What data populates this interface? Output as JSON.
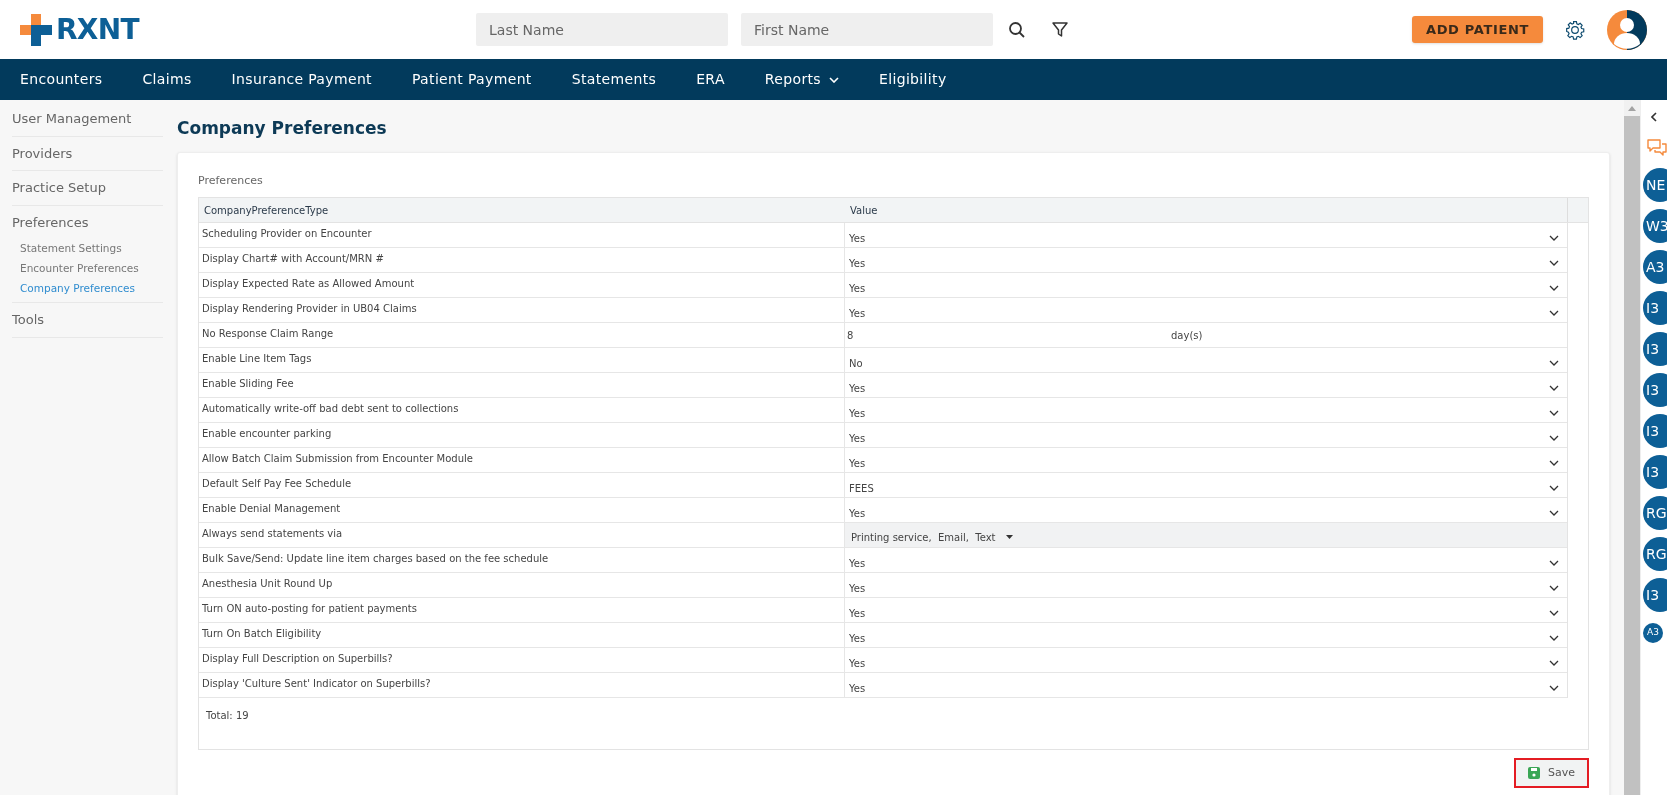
{
  "header": {
    "logo": "RXNT",
    "search": [
      {
        "placeholder": "Last Name"
      },
      {
        "placeholder": "First Name"
      }
    ],
    "add_button": "ADD PATIENT"
  },
  "nav": [
    {
      "label": "Encounters",
      "kind": "link"
    },
    {
      "label": "Claims",
      "kind": "link"
    },
    {
      "label": "Insurance Payment",
      "kind": "link"
    },
    {
      "label": "Patient Payment",
      "kind": "link"
    },
    {
      "label": "Statements",
      "kind": "link"
    },
    {
      "label": "ERA",
      "kind": "link"
    },
    {
      "label": "Reports",
      "kind": "menu"
    },
    {
      "label": "Eligibility",
      "kind": "link"
    }
  ],
  "sidebar": {
    "items": [
      {
        "label": "User Management",
        "selected": false
      },
      {
        "label": "Providers",
        "selected": false
      },
      {
        "label": "Practice Setup",
        "selected": false
      },
      {
        "label": "Preferences",
        "selected": false,
        "children": [
          {
            "label": "Statement Settings",
            "selected": false
          },
          {
            "label": "Encounter Preferences",
            "selected": false
          },
          {
            "label": "Company Preferences",
            "selected": true
          }
        ]
      },
      {
        "label": "Tools",
        "selected": false
      }
    ]
  },
  "page_title": "Company Preferences",
  "section_label": "Preferences",
  "table": {
    "columns": [
      "CompanyPreferenceType",
      "Value"
    ],
    "rows": [
      {
        "type": "Scheduling Provider on Encounter",
        "kind": "select",
        "value": "Yes"
      },
      {
        "type": "Display Chart# with Account/MRN #",
        "kind": "select",
        "value": "Yes"
      },
      {
        "type": "Display Expected Rate as Allowed Amount",
        "kind": "select",
        "value": "Yes"
      },
      {
        "type": "Display Rendering Provider in UB04 Claims",
        "kind": "select",
        "value": "Yes"
      },
      {
        "type": "No Response Claim Range",
        "kind": "number",
        "value": "8",
        "unit": "day(s)"
      },
      {
        "type": "Enable Line Item Tags",
        "kind": "select",
        "value": "No"
      },
      {
        "type": "Enable Sliding Fee",
        "kind": "select",
        "value": "Yes"
      },
      {
        "type": "Automatically write-off bad debt sent to collections",
        "kind": "select",
        "value": "Yes"
      },
      {
        "type": "Enable encounter parking",
        "kind": "select",
        "value": "Yes"
      },
      {
        "type": "Allow Batch Claim Submission from Encounter Module",
        "kind": "select",
        "value": "Yes"
      },
      {
        "type": "Default Self Pay Fee Schedule",
        "kind": "select",
        "value": "FEES"
      },
      {
        "type": "Enable Denial Management",
        "kind": "select",
        "value": "Yes"
      },
      {
        "type": "Always send statements via",
        "kind": "multiselect",
        "value": "Printing service,  Email,  Text"
      },
      {
        "type": "Bulk Save/Send: Update line item charges based on the fee schedule",
        "kind": "select",
        "value": "Yes"
      },
      {
        "type": "Anesthesia Unit Round Up",
        "kind": "select",
        "value": "Yes"
      },
      {
        "type": "Turn ON auto-posting for patient payments",
        "kind": "select",
        "value": "Yes"
      },
      {
        "type": "Turn On Batch Eligibility",
        "kind": "select",
        "value": "Yes"
      },
      {
        "type": "Display Full Description on Superbills?",
        "kind": "select",
        "value": "Yes"
      },
      {
        "type": "Display 'Culture Sent' Indicator on Superbills?",
        "kind": "select",
        "value": "Yes"
      }
    ],
    "total": "Total: 19"
  },
  "save_button": "Save",
  "right_panel": {
    "users": [
      {
        "initials": "NE",
        "kind": "avatar"
      },
      {
        "initials": "W3",
        "kind": "avatar"
      },
      {
        "initials": "A3",
        "kind": "avatar"
      },
      {
        "initials": "I3",
        "kind": "avatar"
      },
      {
        "initials": "I3",
        "kind": "avatar"
      },
      {
        "initials": "I3",
        "kind": "avatar"
      },
      {
        "initials": "I3",
        "kind": "avatar"
      },
      {
        "initials": "I3",
        "kind": "avatar"
      },
      {
        "initials": "RG",
        "kind": "avatar"
      },
      {
        "initials": "RG",
        "kind": "avatar"
      },
      {
        "initials": "I3",
        "kind": "avatar"
      },
      {
        "initials": "A3",
        "kind": "mini"
      }
    ]
  }
}
